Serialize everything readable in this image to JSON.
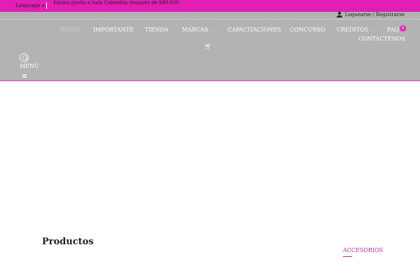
{
  "topbar": {
    "language_label": "Language",
    "promo_text": "Envíos gratis a toda Colombia después de $90.000",
    "background": "#e21fb4"
  },
  "header": {
    "account_link": "Loguearse / Registrarse",
    "background": "#b3b3b3",
    "nav": [
      {
        "label": "INICIO",
        "active": true
      },
      {
        "label": "IMPORTANTE"
      },
      {
        "label": "TIENDA"
      },
      {
        "label": "MARCAS",
        "has_dropdown": true
      },
      {
        "label": "CAPACITACIONES"
      },
      {
        "label": "CONCURSO"
      },
      {
        "label": "CREDITOS",
        "has_dropdown": true
      },
      {
        "label": "FAQ"
      },
      {
        "label": "CONTACTENOS"
      }
    ],
    "cart_count": "0",
    "menu_label": "MENÚ",
    "icons": [
      "user-icon",
      "cart-icon",
      "search-icon",
      "hamburger-icon"
    ]
  },
  "main": {
    "section_title": "Productos",
    "category_tab": "ACCESORIOS",
    "accent": "#b52fa6"
  }
}
